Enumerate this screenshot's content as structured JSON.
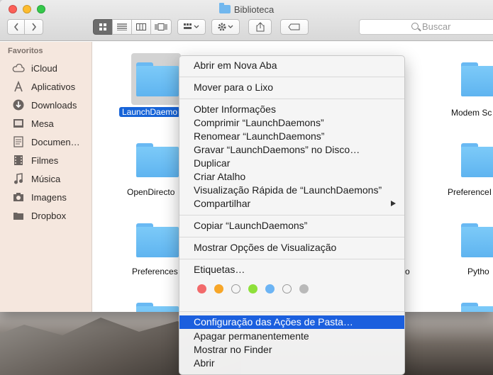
{
  "window": {
    "title": "Biblioteca"
  },
  "toolbar": {
    "search_placeholder": "Buscar",
    "icons": [
      "back-icon",
      "forward-icon",
      "icon-view",
      "list-view",
      "column-view",
      "coverflow-view",
      "arrange-icon",
      "gear-icon",
      "share-icon",
      "tag-icon"
    ]
  },
  "sidebar": {
    "header": "Favoritos",
    "items": [
      {
        "label": "iCloud",
        "icon": "cloud-icon"
      },
      {
        "label": "Aplicativos",
        "icon": "applications-icon"
      },
      {
        "label": "Downloads",
        "icon": "downloads-icon"
      },
      {
        "label": "Mesa",
        "icon": "desktop-icon"
      },
      {
        "label": "Documen…",
        "icon": "documents-icon"
      },
      {
        "label": "Filmes",
        "icon": "movies-icon"
      },
      {
        "label": "Música",
        "icon": "music-icon"
      },
      {
        "label": "Imagens",
        "icon": "pictures-icon"
      },
      {
        "label": "Dropbox",
        "icon": "folder-icon"
      }
    ]
  },
  "files": [
    {
      "name": "LaunchDaemo"
    },
    {
      "name": "Modem Sc"
    },
    {
      "name": "OpenDirecto"
    },
    {
      "name": "PreferenceI"
    },
    {
      "name": "Preferences"
    },
    {
      "name": "o"
    },
    {
      "name": "Pytho"
    }
  ],
  "context_menu": {
    "groups": [
      [
        "Abrir em Nova Aba"
      ],
      [
        "Mover para o Lixo"
      ],
      [
        "Obter Informações",
        "Comprimir “LaunchDaemons”",
        "Renomear “LaunchDaemons”",
        "Gravar “LaunchDaemons” no Disco…",
        "Duplicar",
        "Criar Atalho",
        "Visualização Rápida de “LaunchDaemons”",
        "Compartilhar"
      ],
      [
        "Copiar “LaunchDaemons”"
      ],
      [
        "Mostrar Opções de Visualização"
      ],
      [
        "Etiquetas…"
      ],
      [
        "Configuração das Ações de Pasta…",
        "Apagar permanentemente",
        "Mostrar no Finder",
        "Abrir"
      ]
    ],
    "highlighted": "Configuração das Ações de Pasta…",
    "tag_colors": [
      "#f26a6b",
      "#f7a628",
      "transparent",
      "#8ee03a",
      "#6cb4f4",
      "transparent",
      "#b9b9b9"
    ]
  }
}
